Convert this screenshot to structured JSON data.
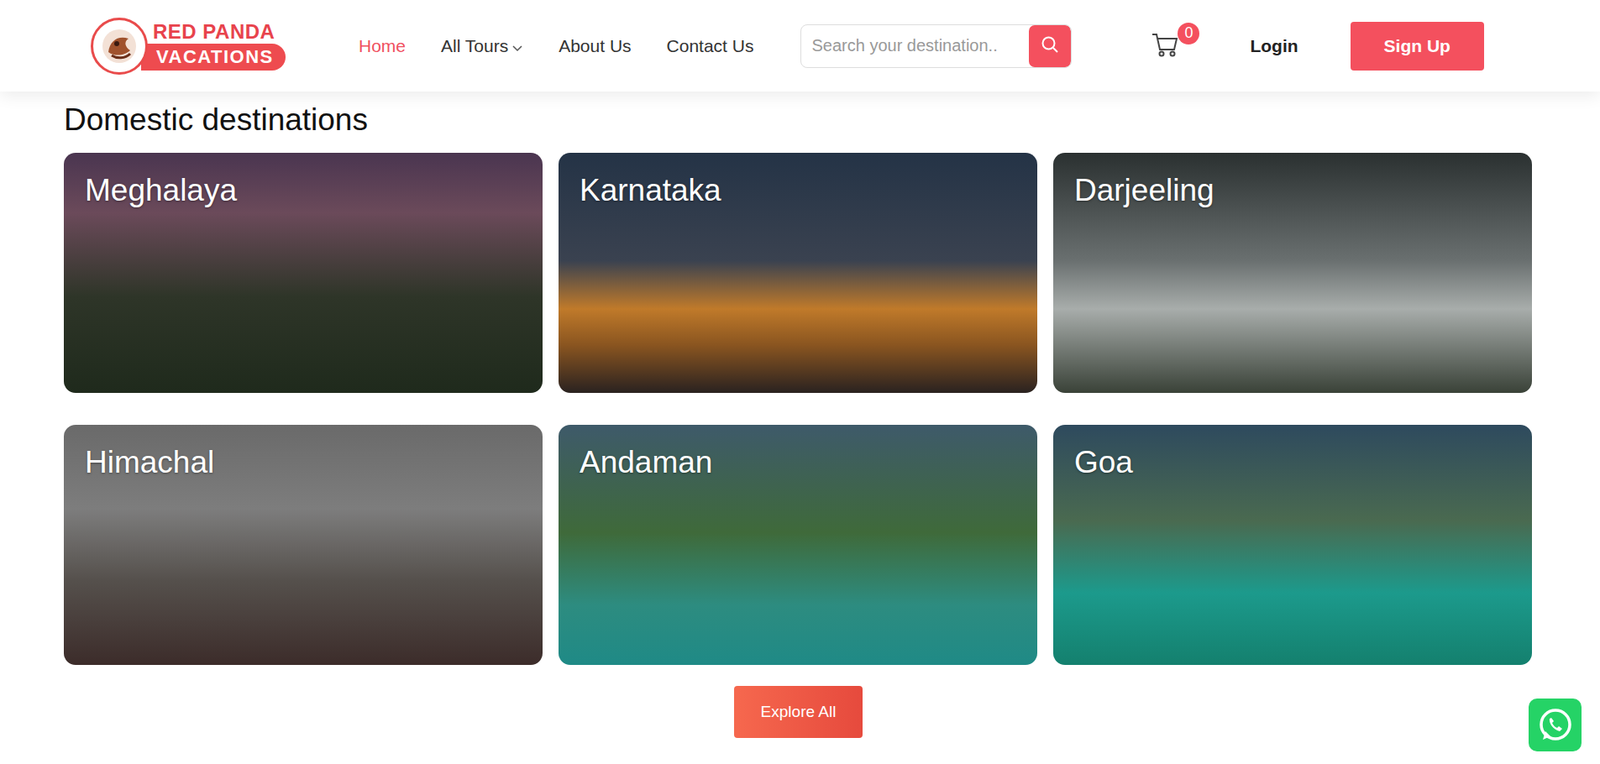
{
  "logo": {
    "top": "RED PANDA",
    "bottom": "VACATIONS"
  },
  "nav": [
    {
      "label": "Home",
      "selected": true,
      "dropdown": false
    },
    {
      "label": "All Tours",
      "selected": false,
      "dropdown": true
    },
    {
      "label": "About Us",
      "selected": false,
      "dropdown": false
    },
    {
      "label": "Contact Us",
      "selected": false,
      "dropdown": false
    }
  ],
  "search": {
    "placeholder": "Search your destination.."
  },
  "cart": {
    "count": "0"
  },
  "login": "Login",
  "signup": "Sign Up",
  "section": {
    "title": "Domestic destinations",
    "cards": [
      {
        "name": "Meghalaya"
      },
      {
        "name": "Karnataka"
      },
      {
        "name": "Darjeeling"
      },
      {
        "name": "Himachal"
      },
      {
        "name": "Andaman"
      },
      {
        "name": "Goa"
      }
    ],
    "button": "Explore All"
  }
}
